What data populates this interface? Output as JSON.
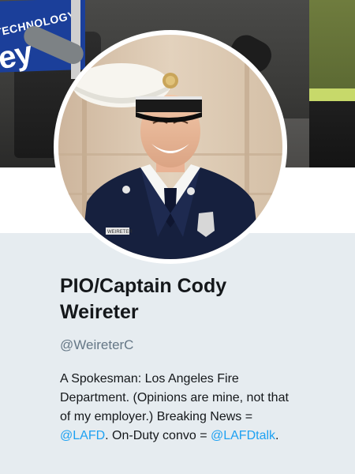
{
  "banner": {
    "sign_small_text": "TECHNOLOGY",
    "sign_big_text": "ey"
  },
  "avatar": {
    "name_tag_text": "WEIRETER"
  },
  "profile": {
    "display_name_line1": "PIO/Captain Cody",
    "display_name_line2": "Weireter",
    "handle": "@WeireterC",
    "bio": {
      "line1": "A Spokesman: Los Angeles Fire",
      "line2": "Department. (Opinions are mine, not that",
      "line3": "of my employer.) Breaking News =",
      "line4_link1": "@LAFD",
      "line4_middle": ". On-Duty convo = ",
      "line4_link2": "@LAFDtalk",
      "line4_end": "."
    }
  },
  "colors": {
    "page_background": "#e6ecf0",
    "link": "#1da1f2",
    "handle_gray": "#657786",
    "text_dark": "#14171a"
  }
}
